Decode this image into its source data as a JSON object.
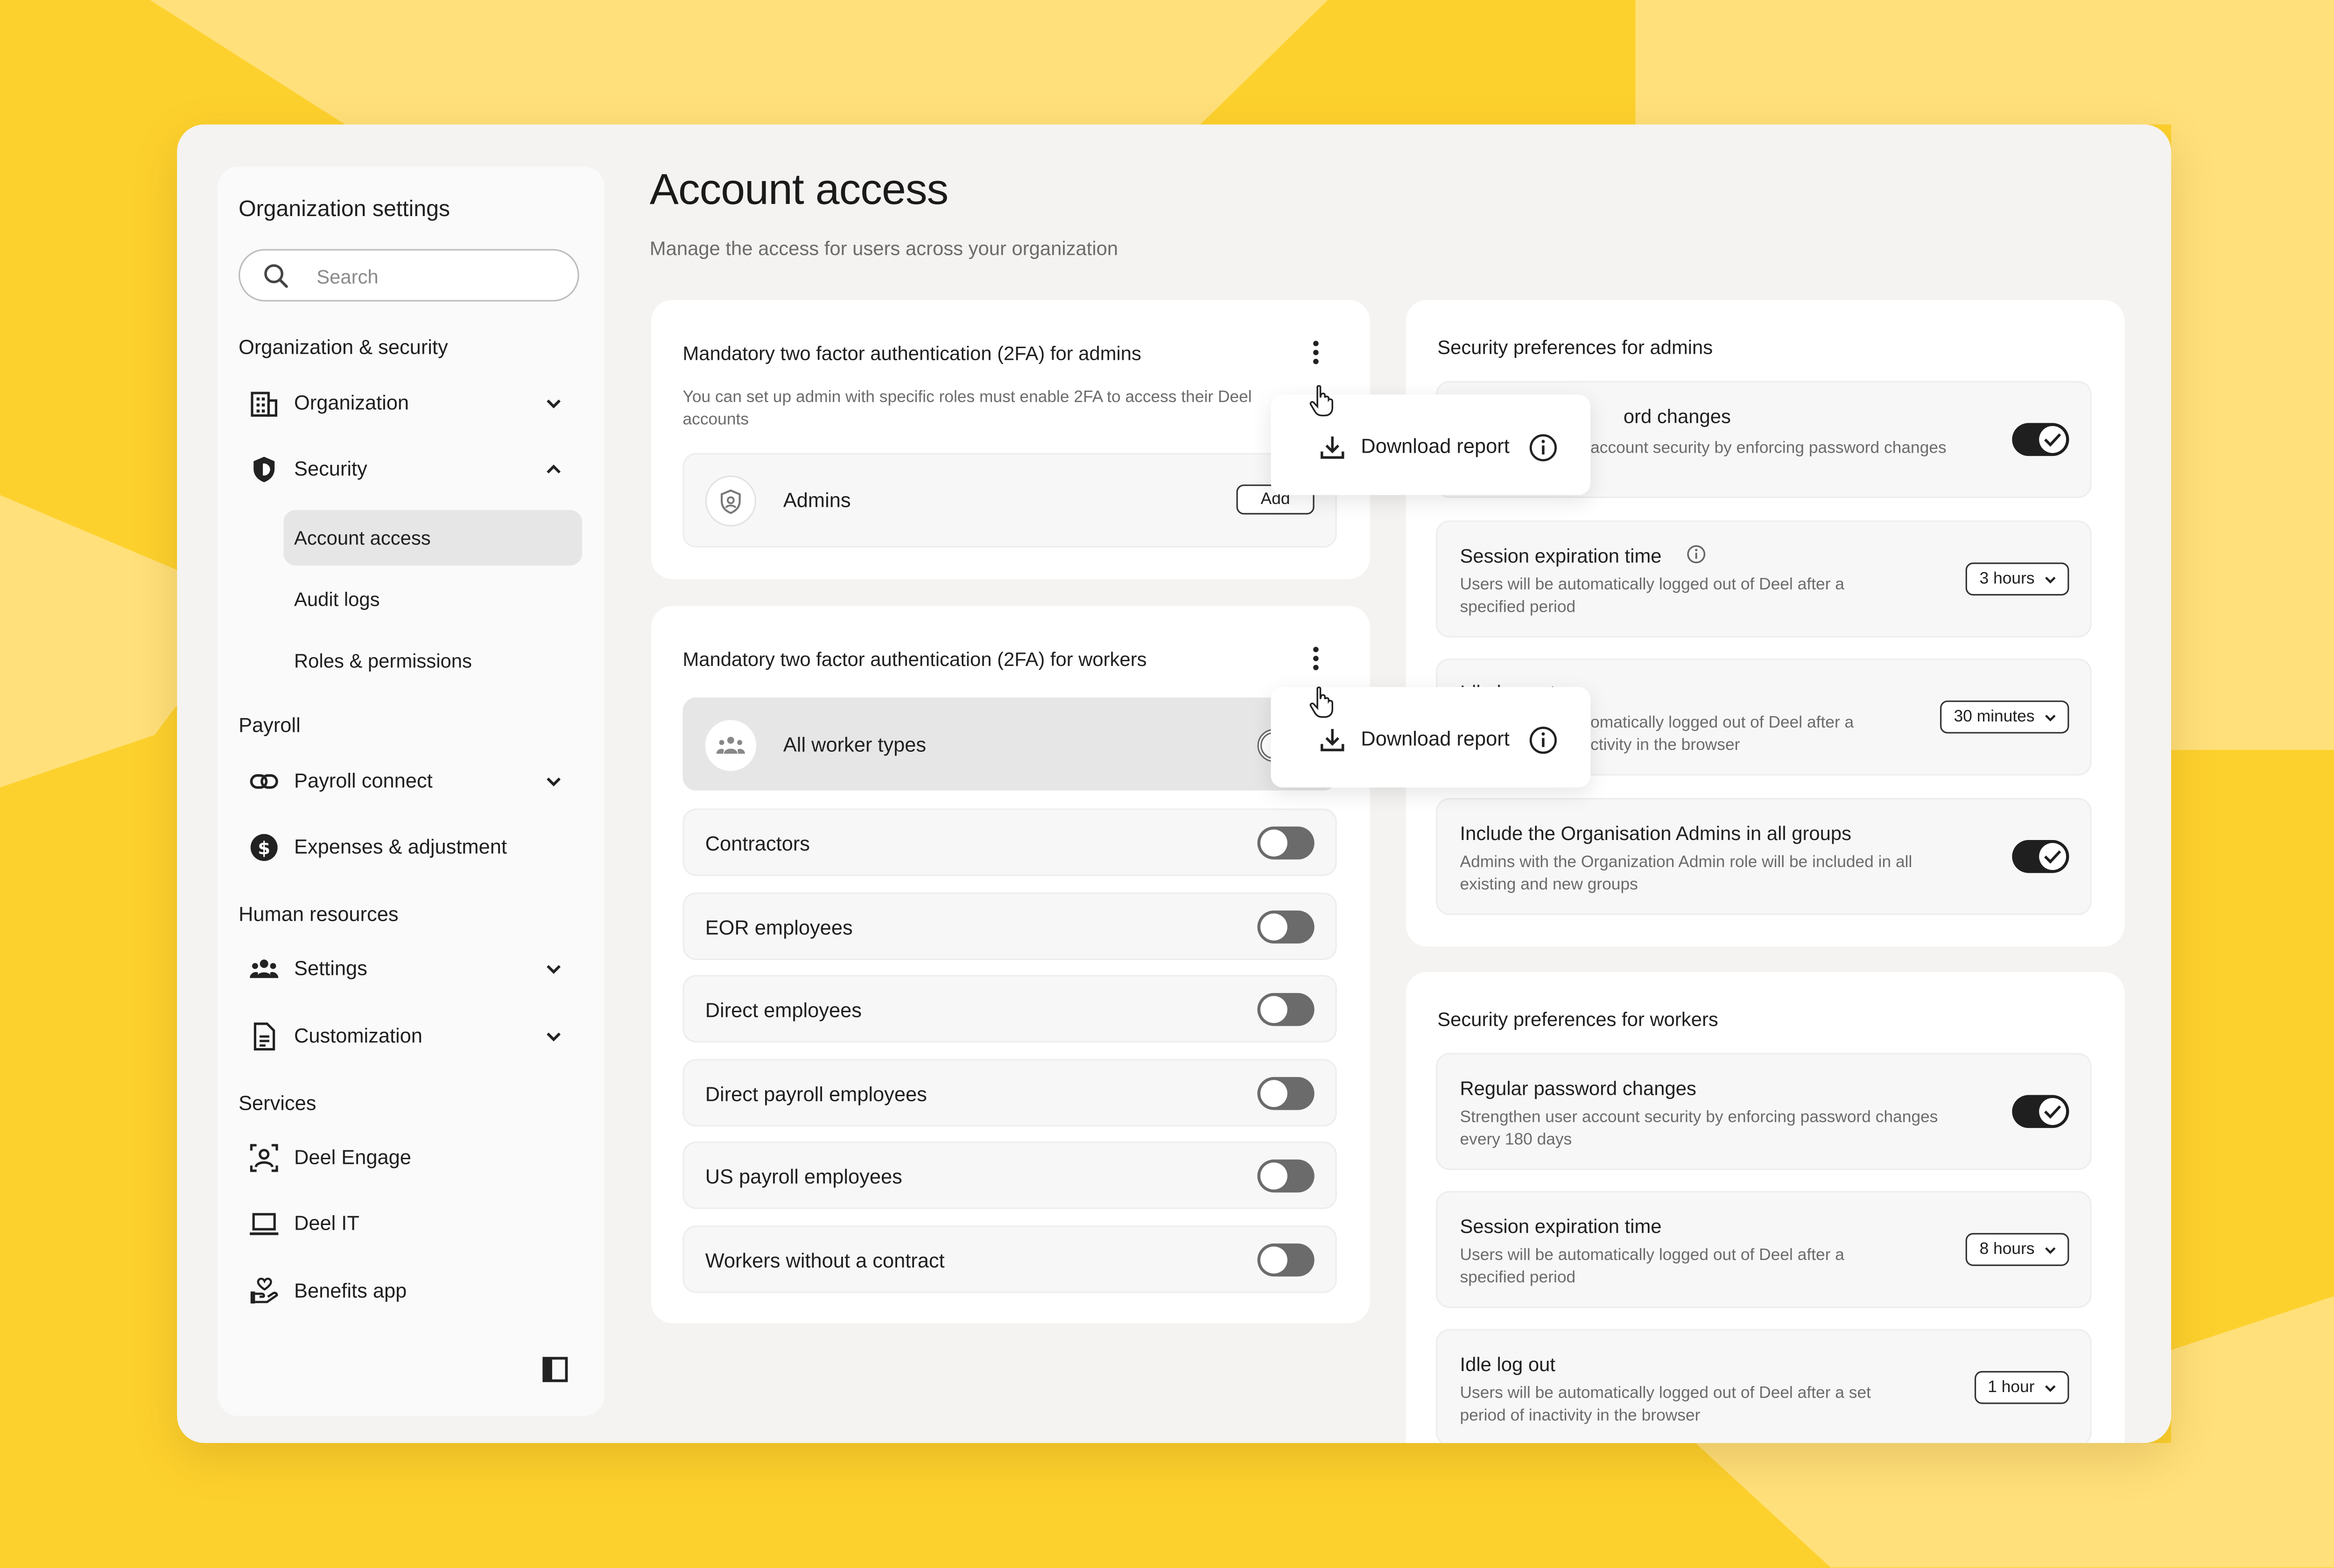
{
  "sidebar": {
    "title": "Organization settings",
    "search_placeholder": "Search",
    "sections": {
      "org_security": "Organization & security",
      "payroll": "Payroll",
      "human_resources": "Human resources",
      "services": "Services"
    },
    "items": {
      "organization": "Organization",
      "security": "Security",
      "account_access": "Account access",
      "audit_logs": "Audit logs",
      "roles_permissions": "Roles & permissions",
      "payroll_connect": "Payroll connect",
      "expenses": "Expenses & adjustment",
      "settings": "Settings",
      "customization": "Customization",
      "deel_engage": "Deel Engage",
      "deel_it": "Deel IT",
      "benefits_app": "Benefits app"
    },
    "icons": [
      "building-icon",
      "shield-icon",
      "link-icon",
      "dollar-icon",
      "people-icon",
      "document-icon",
      "person-badge-icon",
      "laptop-icon",
      "hand-heart-icon",
      "sidebar-collapse-icon"
    ]
  },
  "page": {
    "title": "Account access",
    "subtitle": "Manage the access for users across your organization"
  },
  "admins_2fa": {
    "title": "Mandatory two factor authentication (2FA) for admins",
    "description_line1": "You can set up admin with specific roles must enable 2FA to access their Deel",
    "description_line2": "accounts",
    "row_label": "Admins",
    "add_label": "Add"
  },
  "workers_2fa": {
    "title": "Mandatory two factor authentication (2FA) for workers",
    "rows": [
      {
        "label": "All worker types",
        "on": false
      },
      {
        "label": "Contractors",
        "on": false
      },
      {
        "label": "EOR employees",
        "on": false
      },
      {
        "label": "Direct employees",
        "on": false
      },
      {
        "label": "Direct payroll employees",
        "on": false
      },
      {
        "label": "US payroll employees",
        "on": false
      },
      {
        "label": "Workers without a contract",
        "on": false
      }
    ]
  },
  "popup": {
    "label": "Download report"
  },
  "admin_prefs": {
    "title": "Security preferences for admins",
    "items": [
      {
        "title_visible": "ord changes",
        "desc_visible": "account security by enforcing password changes",
        "toggle": true
      },
      {
        "title": "Session expiration time",
        "desc1": "Users will be automatically logged out of Deel after a",
        "desc2": "specified period",
        "dropdown": "3 hours"
      },
      {
        "title_visible": "Idle log out",
        "desc1_visible": "omatically logged out of Deel after a",
        "desc2_visible": "ctivity in the browser",
        "dropdown": "30 minutes"
      },
      {
        "title": "Include the Organisation Admins in all groups",
        "desc1": "Admins with the Organization Admin role will be included in all",
        "desc2": "existing and new groups",
        "toggle": true
      }
    ]
  },
  "worker_prefs": {
    "title": "Security preferences for workers",
    "items": [
      {
        "title": "Regular password changes",
        "desc1": "Strengthen user account security by enforcing password changes",
        "desc2": "every 180 days",
        "toggle": true
      },
      {
        "title": "Session expiration time",
        "desc1": "Users will be automatically logged out of Deel after a",
        "desc2": "specified period",
        "dropdown": "8 hours"
      },
      {
        "title": "Idle log out",
        "desc1": "Users will be automatically logged out of Deel after a set",
        "desc2": "period of inactivity in the browser",
        "dropdown": "1 hour"
      }
    ]
  },
  "colors": {
    "background_yellow": "#fdd12d",
    "background_light_yellow": "#ffe07a",
    "toggle_on": "#1f1f1f",
    "toggle_off": "#6b6b6b"
  }
}
